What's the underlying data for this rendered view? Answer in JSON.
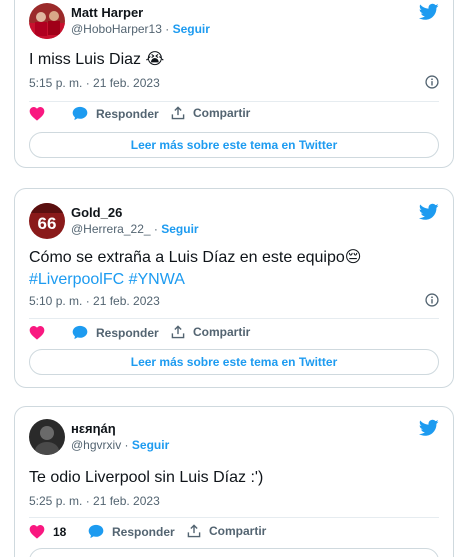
{
  "tweets": [
    {
      "name": "Matt Harper",
      "handle": "@HoboHarper13",
      "separator": "·",
      "follow_label": "Seguir",
      "text": "I miss Luis Diaz 😭",
      "time": "5:15 p. m. · 21 feb. 2023",
      "like_count": "",
      "reply_label": "Responder",
      "share_label": "Compartir",
      "more_label": "Leer más sobre este tema en Twitter"
    },
    {
      "name": "Gold_26",
      "handle": "@Herrera_22_",
      "separator": "·",
      "follow_label": "Seguir",
      "text": "Cómo se extraña a Luis Díaz en este equipo😔",
      "hashtags": "#LiverpoolFC #YNWA",
      "avatar_number": "66",
      "time": "5:10 p. m. · 21 feb. 2023",
      "like_count": "",
      "reply_label": "Responder",
      "share_label": "Compartir",
      "more_label": "Leer más sobre este tema en Twitter"
    },
    {
      "name": "нεяηáη",
      "handle": "@hgvrxiv",
      "separator": "·",
      "follow_label": "Seguir",
      "text": "Te odio Liverpool sin Luis Díaz :')",
      "time": "5:25 p. m. · 21 feb. 2023",
      "like_count": "18",
      "reply_label": "Responder",
      "share_label": "Compartir"
    }
  ],
  "colors": {
    "accent": "#1d9bf0",
    "like": "#f91880",
    "text": "#0f1419",
    "muted": "#536471",
    "border": "#cfd9de"
  },
  "icons": {
    "brand": "twitter-bird-icon",
    "like": "heart-icon",
    "reply": "speech-bubble-icon",
    "share": "share-arrow-icon",
    "info": "info-circle-icon"
  }
}
